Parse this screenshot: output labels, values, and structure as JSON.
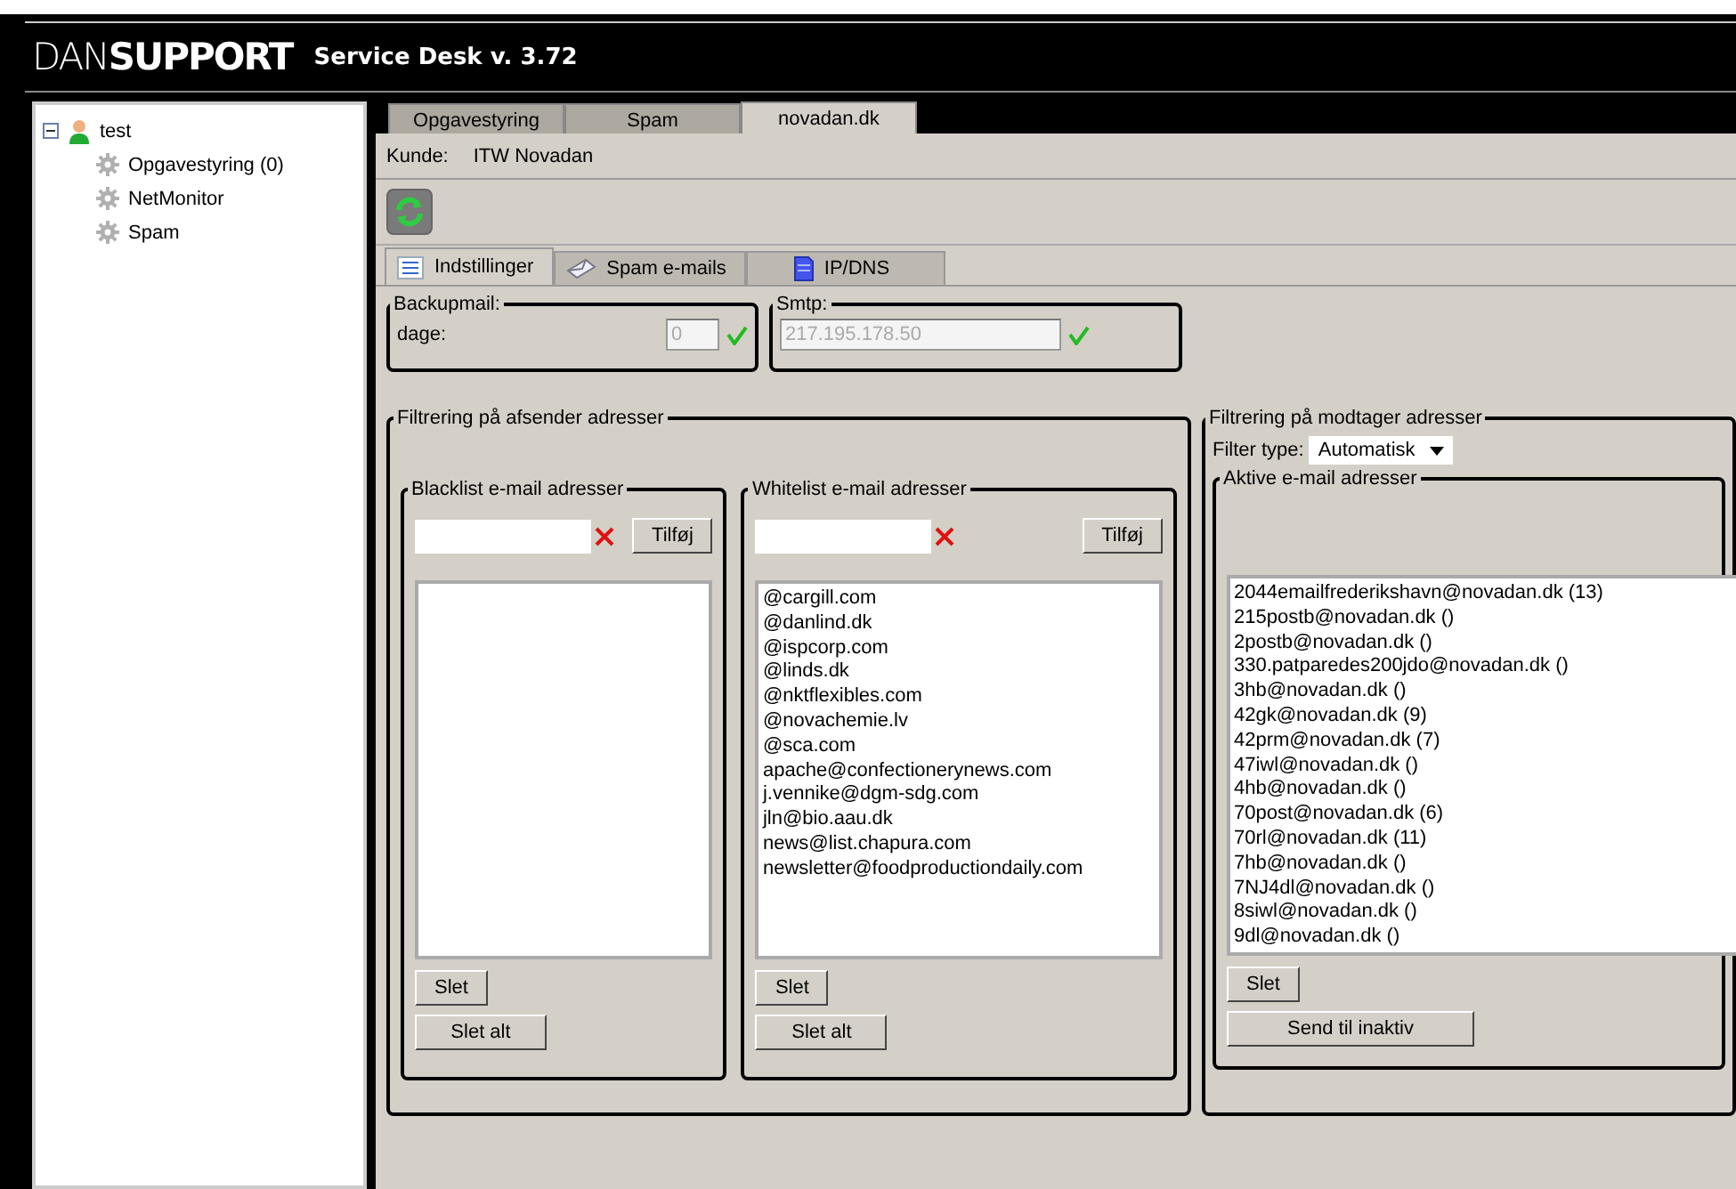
{
  "header": {
    "logo_light": "DAN",
    "logo_bold": "SUPPORT",
    "title": "Service Desk v. 3.72"
  },
  "tree": {
    "label": "test",
    "expanded": true,
    "children": [
      {
        "label": "Opgavestyring (0)"
      },
      {
        "label": "NetMonitor"
      },
      {
        "label": "Spam"
      }
    ]
  },
  "tabs": [
    {
      "label": "Opgavestyring",
      "selected": false
    },
    {
      "label": "Spam",
      "selected": false
    },
    {
      "label": "novadan.dk",
      "selected": true
    }
  ],
  "customer": {
    "label": "Kunde:",
    "value": "ITW Novadan"
  },
  "subtabs": [
    {
      "label": "Indstillinger",
      "kind": "settings",
      "selected": true
    },
    {
      "label": "Spam e-mails",
      "kind": "mail",
      "selected": false
    },
    {
      "label": "IP/DNS",
      "kind": "document",
      "selected": false
    }
  ],
  "backupmail": {
    "title": "Backupmail:",
    "label": "dage:",
    "value": "0",
    "disabled": true
  },
  "smtp": {
    "title": "Smtp:",
    "value": "217.195.178.50",
    "disabled": true
  },
  "sender_filter": {
    "title": "Filtrering på afsender adresser",
    "blacklist": {
      "title": "Blacklist e-mail adresser",
      "add": "Tilføj",
      "delete": "Slet",
      "delete_all": "Slet alt"
    },
    "whitelist": {
      "title": "Whitelist e-mail adresser",
      "add": "Tilføj",
      "items": [
        "@cargill.com",
        "@danlind.dk",
        "@ispcorp.com",
        "@linds.dk",
        "@nktflexibles.com",
        "@novachemie.lv",
        "@sca.com",
        "apache@confectionerynews.com",
        "j.vennike@dgm-sdg.com",
        "jln@bio.aau.dk",
        "news@list.chapura.com",
        "newsletter@foodproductiondaily.com"
      ],
      "delete": "Slet",
      "delete_all": "Slet alt"
    }
  },
  "recipient_filter": {
    "title": "Filtrering på modtager adresser",
    "filter_label": "Filter type:",
    "filter_value": "Automatisk",
    "active": {
      "title": "Aktive e-mail adresser",
      "items": [
        "2044emailfrederikshavn@novadan.dk  (13)",
        "215postb@novadan.dk  ()",
        "2postb@novadan.dk  ()",
        "330.patparedes200jdo@novadan.dk  ()",
        "3hb@novadan.dk  ()",
        "42gk@novadan.dk  (9)",
        "42prm@novadan.dk  (7)",
        "47iwl@novadan.dk  ()",
        "4hb@novadan.dk  ()",
        "70post@novadan.dk  (6)",
        "70rl@novadan.dk  (11)",
        "7hb@novadan.dk  ()",
        "7NJ4dl@novadan.dk  ()",
        "8siwl@novadan.dk  ()",
        "9dl@novadan.dk  ()"
      ],
      "delete": "Slet",
      "send_inactive": "Send til inaktiv"
    }
  }
}
